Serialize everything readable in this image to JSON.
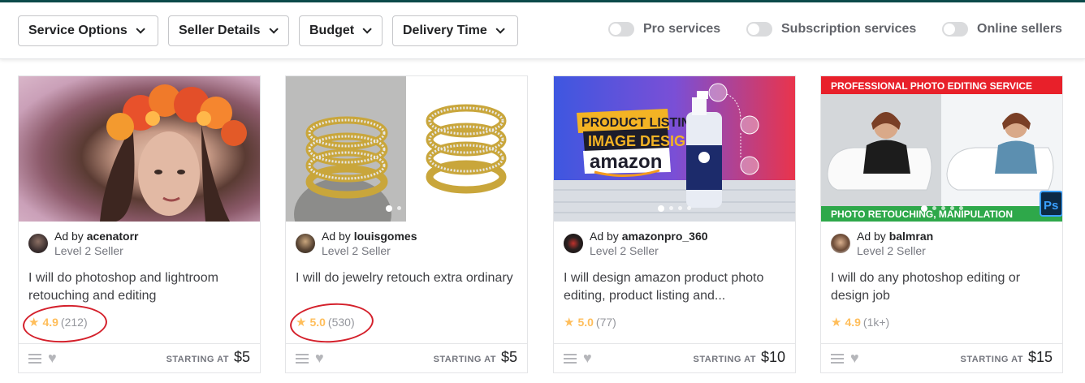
{
  "filters": {
    "dropdowns": [
      "Service Options",
      "Seller Details",
      "Budget",
      "Delivery Time"
    ],
    "toggles": [
      "Pro services",
      "Subscription services",
      "Online sellers"
    ]
  },
  "cards": [
    {
      "ad_prefix": "Ad by ",
      "seller": "acenatorr",
      "level": "Level 2 Seller",
      "title": "I will do photoshop and lightroom retouching and editing",
      "score": "4.9",
      "count": "(212)",
      "starting": "STARTING AT",
      "price": "$5"
    },
    {
      "ad_prefix": "Ad by ",
      "seller": "louisgomes",
      "level": "Level 2 Seller",
      "title": "I will do jewelry retouch extra ordinary",
      "score": "5.0",
      "count": "(530)",
      "starting": "STARTING AT",
      "price": "$5"
    },
    {
      "ad_prefix": "Ad by ",
      "seller": "amazonpro_360",
      "level": "Level 2 Seller",
      "title": "I will design amazon product photo editing, product listing and...",
      "score": "5.0",
      "count": "(77)",
      "starting": "STARTING AT",
      "price": "$10",
      "thumb_text": [
        "PRODUCT LISTING",
        "IMAGE DESIGN",
        "amazon"
      ]
    },
    {
      "ad_prefix": "Ad by ",
      "seller": "balmran",
      "level": "Level 2 Seller",
      "title": "I will do any photoshop editing or design job",
      "score": "4.9",
      "count": "(1k+)",
      "starting": "STARTING AT",
      "price": "$15",
      "thumb_text": [
        "PROFESSIONAL PHOTO EDITING SERVICE",
        "PHOTO RETOUCHING, MANIPULATION",
        "Ps"
      ]
    }
  ],
  "colors": {
    "accent_line": "#0c4a4a",
    "star": "#ffbe5b",
    "annotation": "#d4202b"
  }
}
